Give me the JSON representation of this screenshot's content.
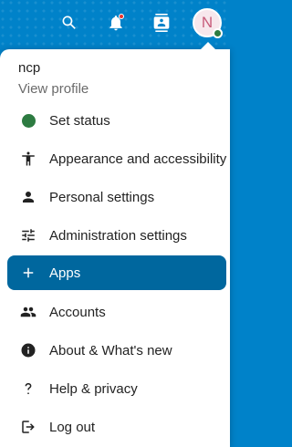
{
  "header": {
    "avatar_initial": "N",
    "colors": {
      "primary": "#0082c9",
      "active_item": "#00679e",
      "status_online": "#2d7b41",
      "notification": "#e9322d"
    }
  },
  "profile": {
    "name": "ncp",
    "link": "View profile"
  },
  "menu": {
    "items": [
      {
        "label": "Set status",
        "icon": "status-dot-icon"
      },
      {
        "label": "Appearance and accessibility",
        "icon": "accessibility-icon"
      },
      {
        "label": "Personal settings",
        "icon": "person-icon"
      },
      {
        "label": "Administration settings",
        "icon": "tune-icon"
      },
      {
        "label": "Apps",
        "icon": "plus-icon",
        "active": true
      },
      {
        "label": "Accounts",
        "icon": "accounts-icon"
      },
      {
        "label": "About & What's new",
        "icon": "info-icon"
      },
      {
        "label": "Help & privacy",
        "icon": "help-icon"
      },
      {
        "label": "Log out",
        "icon": "logout-icon"
      }
    ]
  }
}
